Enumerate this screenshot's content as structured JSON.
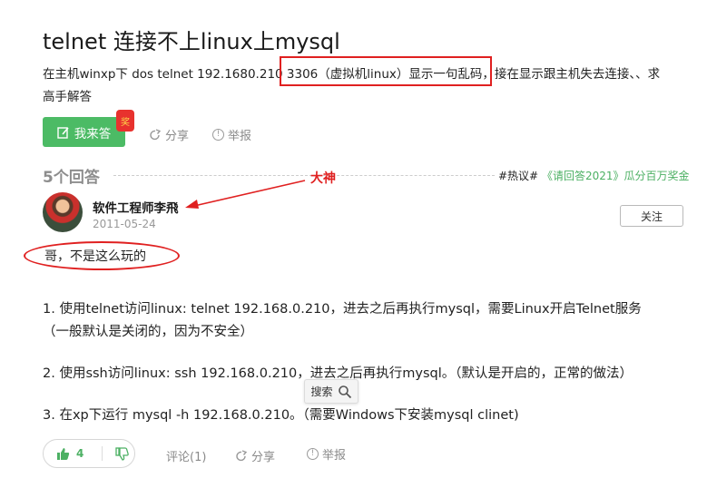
{
  "question": {
    "title": "telnet 连接不上linux上mysql",
    "body_line1": "在主机winxp下 dos telnet 192.1680.210 3306（虚拟机linux）显示一句乱码，接在显示跟主机失去连接、、求",
    "body_line2": "高手解答",
    "answer_button": "我来答",
    "redpacket_glyph": "奖",
    "share": "分享",
    "report": "举报"
  },
  "answers_header": {
    "count": "5个回答",
    "promo_tag": "#热议#",
    "promo_link": "《请回答2021》瓜分百万奖金"
  },
  "annotation": {
    "label": "大神",
    "color": "#e02020"
  },
  "answer": {
    "author": "软件工程师李飛",
    "date": "2011-05-24",
    "follow": "关注",
    "lead": "哥，不是这么玩的",
    "para1_line1": "1. 使用telnet访问linux: telnet 192.168.0.210，进去之后再执行mysql，需要Linux开启Telnet服务",
    "para1_line2": "（一般默认是关闭的，因为不安全）",
    "para2": "2. 使用ssh访问linux: ssh 192.168.0.210，进去之后再执行mysql。（默认是开启的，正常的做法）",
    "para3": "3. 在xp下运行 mysql -h 192.168.0.210。（需要Windows下安装mysql clinet)",
    "likes": "4",
    "comment": "评论(1)",
    "share": "分享",
    "report": "举报"
  },
  "search_chip": {
    "label": "搜索"
  },
  "colors": {
    "brand_green": "#4cbb65",
    "annotation_red": "#e02020"
  }
}
